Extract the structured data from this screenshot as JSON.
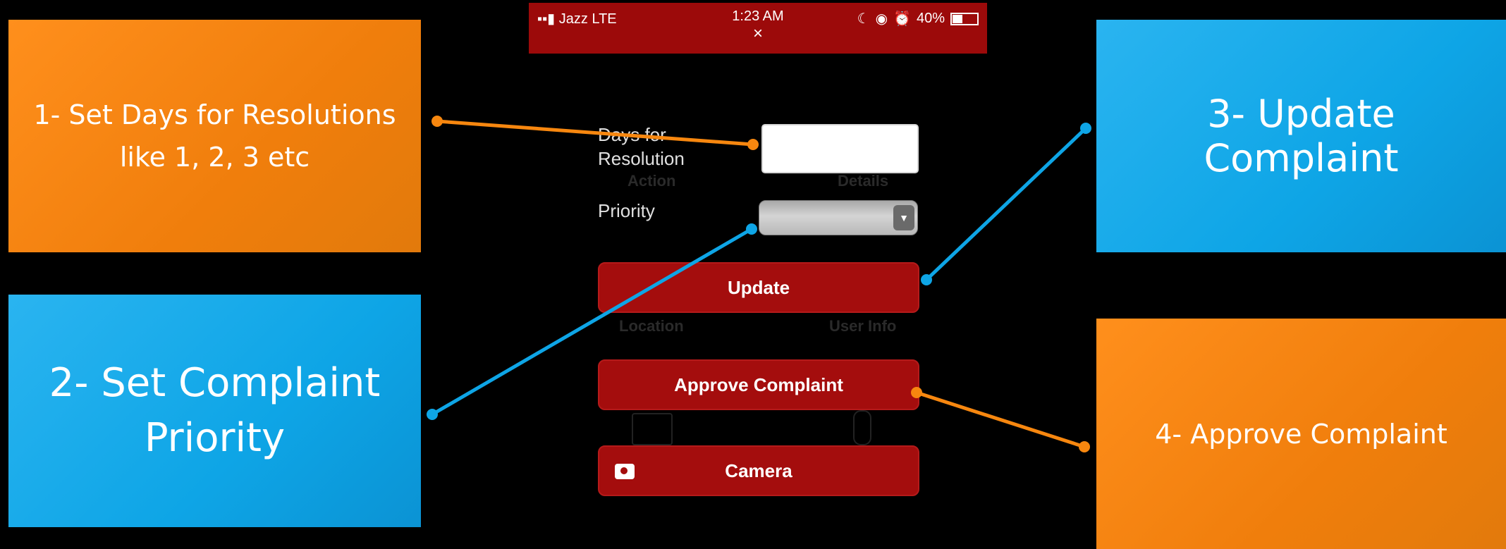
{
  "callouts": {
    "set_days": [
      "1- Set Days for Resolutions",
      "like 1, 2, 3 etc"
    ],
    "set_priority": [
      "2- Set Complaint",
      "Priority"
    ],
    "update": "3- Update Complaint",
    "approve": "4- Approve Complaint"
  },
  "status_bar": {
    "carrier": "Jazz",
    "network": "LTE",
    "time": "1:23 AM",
    "battery": "40%",
    "close_glyph": "×"
  },
  "form": {
    "days_label_line1": "Days for",
    "days_label_line2": "Resolution",
    "days_value": "",
    "priority_label": "Priority",
    "priority_value": "",
    "update_label": "Update",
    "approve_label": "Approve Complaint",
    "camera_label": "Camera"
  },
  "background_menu": {
    "action": "Action",
    "details": "Details",
    "location": "Location",
    "user_info": "User Info"
  },
  "colors": {
    "orange": "#f7870f",
    "blue": "#0ea5e6",
    "button_red": "#a40d0d"
  },
  "icons": [
    "signal-icon",
    "moon-icon",
    "lock-rotation-icon",
    "alarm-icon",
    "battery-icon",
    "camera-icon",
    "close-icon",
    "dropdown-arrow-icon",
    "image-icon",
    "microphone-icon"
  ]
}
